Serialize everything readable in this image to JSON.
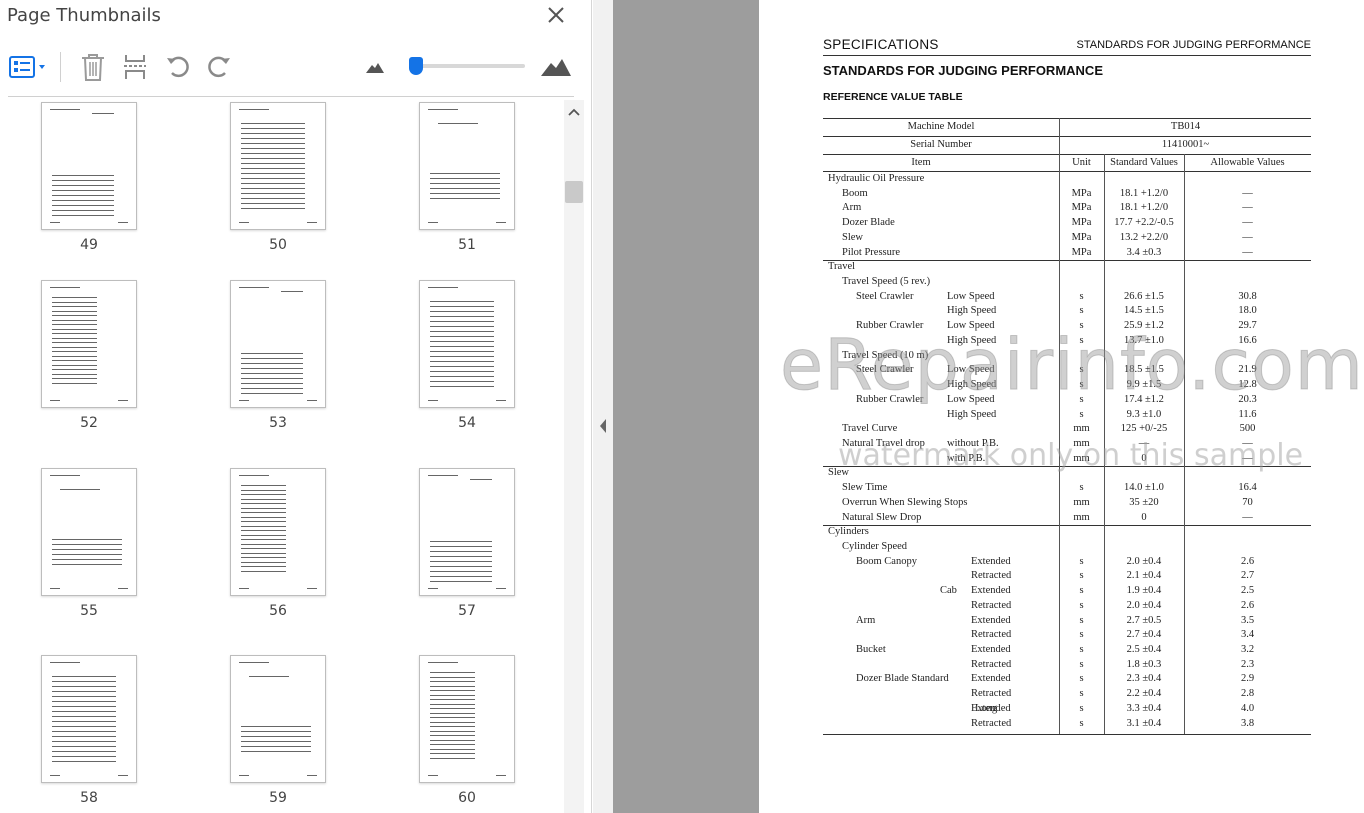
{
  "panel": {
    "title": "Page Thumbnails",
    "close_icon": "close-icon",
    "toolbar": {
      "options_icon": "thumbnail-options-icon",
      "delete_icon": "trash-icon",
      "insert_icon": "insert-pages-icon",
      "undo_icon": "rotate-counterclockwise-icon",
      "redo_icon": "rotate-clockwise-icon",
      "zoom_out_icon": "small-mountain-icon",
      "zoom_in_icon": "large-mountain-icon",
      "zoom_level": 0.05
    },
    "accent_color": "#1473e6",
    "thumbnails": [
      {
        "page": "49"
      },
      {
        "page": "50"
      },
      {
        "page": "51"
      },
      {
        "page": "52"
      },
      {
        "page": "53"
      },
      {
        "page": "54"
      },
      {
        "page": "55"
      },
      {
        "page": "56"
      },
      {
        "page": "57"
      },
      {
        "page": "58"
      },
      {
        "page": "59"
      },
      {
        "page": "60"
      }
    ]
  },
  "document": {
    "header_left": "SPECIFICATIONS",
    "header_right": "STANDARDS FOR JUDGING PERFORMANCE",
    "title": "STANDARDS FOR JUDGING PERFORMANCE",
    "subtitle": "REFERENCE VALUE TABLE",
    "table": {
      "machine_model_label": "Machine Model",
      "machine_model_value": "TB014",
      "serial_label": "Serial Number",
      "serial_value": "11410001~",
      "col_item": "Item",
      "col_unit": "Unit",
      "col_standard": "Standard Values",
      "col_allowable": "Allowable Values",
      "rows": [
        {
          "c1": "Hydraulic Oil Pressure",
          "c2": "",
          "c3": "",
          "unit": "",
          "std": "",
          "allow": ""
        },
        {
          "c1": "",
          "c2": "Boom",
          "c3": "",
          "unit": "MPa",
          "std": "18.1 +1.2/0",
          "allow": "—"
        },
        {
          "c1": "",
          "c2": "Arm",
          "c3": "",
          "unit": "MPa",
          "std": "18.1 +1.2/0",
          "allow": "—"
        },
        {
          "c1": "",
          "c2": "Dozer Blade",
          "c3": "",
          "unit": "MPa",
          "std": "17.7 +2.2/-0.5",
          "allow": "—"
        },
        {
          "c1": "",
          "c2": "Slew",
          "c3": "",
          "unit": "MPa",
          "std": "13.2 +2.2/0",
          "allow": "—"
        },
        {
          "c1": "",
          "c2": "Pilot Pressure",
          "c3": "",
          "unit": "MPa",
          "std": "3.4 ±0.3",
          "allow": "—"
        },
        {
          "c1": "Travel",
          "c2": "",
          "c3": "",
          "unit": "",
          "std": "",
          "allow": ""
        },
        {
          "c1": "",
          "c2": "Travel Speed (5 rev.)",
          "c3": "",
          "unit": "",
          "std": "",
          "allow": ""
        },
        {
          "c1": "",
          "c2": "  Steel Crawler",
          "c3": "Low Speed",
          "unit": "s",
          "std": "26.6 ±1.5",
          "allow": "30.8"
        },
        {
          "c1": "",
          "c2": "",
          "c3": "High Speed",
          "unit": "s",
          "std": "14.5 ±1.5",
          "allow": "18.0"
        },
        {
          "c1": "",
          "c2": "  Rubber Crawler",
          "c3": "Low Speed",
          "unit": "s",
          "std": "25.9 ±1.2",
          "allow": "29.7"
        },
        {
          "c1": "",
          "c2": "",
          "c3": "High Speed",
          "unit": "s",
          "std": "13.7 ±1.0",
          "allow": "16.6"
        },
        {
          "c1": "",
          "c2": "Travel Speed (10 m)",
          "c3": "",
          "unit": "",
          "std": "",
          "allow": ""
        },
        {
          "c1": "",
          "c2": "  Steel Crawler",
          "c3": "Low Speed",
          "unit": "s",
          "std": "18.5 ±1.5",
          "allow": "21.9"
        },
        {
          "c1": "",
          "c2": "",
          "c3": "High Speed",
          "unit": "s",
          "std": "9.9 ±1.5",
          "allow": "12.8"
        },
        {
          "c1": "",
          "c2": "  Rubber Crawler",
          "c3": "Low Speed",
          "unit": "s",
          "std": "17.4 ±1.2",
          "allow": "20.3"
        },
        {
          "c1": "",
          "c2": "",
          "c3": "High Speed",
          "unit": "s",
          "std": "9.3 ±1.0",
          "allow": "11.6"
        },
        {
          "c1": "",
          "c2": "Travel Curve",
          "c3": "",
          "unit": "mm",
          "std": "125 +0/-25",
          "allow": "500"
        },
        {
          "c1": "",
          "c2": "Natural Travel drop",
          "c3": "without P.B.",
          "unit": "mm",
          "std": "—",
          "allow": "—"
        },
        {
          "c1": "",
          "c2": "",
          "c3": "with P.B.",
          "unit": "mm",
          "std": "0",
          "allow": "—"
        },
        {
          "c1": "Slew",
          "c2": "",
          "c3": "",
          "unit": "",
          "std": "",
          "allow": ""
        },
        {
          "c1": "",
          "c2": "Slew Time",
          "c3": "",
          "unit": "s",
          "std": "14.0 ±1.0",
          "allow": "16.4"
        },
        {
          "c1": "",
          "c2": "Overrun When Slewing Stops",
          "c3": "",
          "unit": "mm",
          "std": "35 ±20",
          "allow": "70"
        },
        {
          "c1": "",
          "c2": "Natural Slew Drop",
          "c3": "",
          "unit": "mm",
          "std": "0",
          "allow": "—"
        },
        {
          "c1": "Cylinders",
          "c2": "",
          "c3": "",
          "unit": "",
          "std": "",
          "allow": ""
        },
        {
          "c1": "",
          "c2": "Cylinder Speed",
          "c3": "",
          "unit": "",
          "std": "",
          "allow": ""
        },
        {
          "c1": "",
          "c2": "  Boom    Canopy",
          "c3": "Extended",
          "unit": "s",
          "std": "2.0 ±0.4",
          "allow": "2.6"
        },
        {
          "c1": "",
          "c2": "",
          "c3": "Retracted",
          "unit": "s",
          "std": "2.1 ±0.4",
          "allow": "2.7"
        },
        {
          "c1": "",
          "c2": "              Cab",
          "c3": "Extended",
          "unit": "s",
          "std": "1.9 ±0.4",
          "allow": "2.5"
        },
        {
          "c1": "",
          "c2": "",
          "c3": "Retracted",
          "unit": "s",
          "std": "2.0 ±0.4",
          "allow": "2.6"
        },
        {
          "c1": "",
          "c2": "  Arm",
          "c3": "Extended",
          "unit": "s",
          "std": "2.7 ±0.5",
          "allow": "3.5"
        },
        {
          "c1": "",
          "c2": "",
          "c3": "Retracted",
          "unit": "s",
          "std": "2.7 ±0.4",
          "allow": "3.4"
        },
        {
          "c1": "",
          "c2": "  Bucket",
          "c3": "Extended",
          "unit": "s",
          "std": "2.5 ±0.4",
          "allow": "3.2"
        },
        {
          "c1": "",
          "c2": "",
          "c3": "Retracted",
          "unit": "s",
          "std": "1.8 ±0.3",
          "allow": "2.3"
        },
        {
          "c1": "",
          "c2": "  Dozer Blade  Standard",
          "c3": "Extended",
          "unit": "s",
          "std": "2.3 ±0.4",
          "allow": "2.9"
        },
        {
          "c1": "",
          "c2": "",
          "c3": "Retracted",
          "unit": "s",
          "std": "2.2 ±0.4",
          "allow": "2.8"
        },
        {
          "c1": "",
          "c2": "                   Long",
          "c3": "Extended",
          "unit": "s",
          "std": "3.3 ±0.4",
          "allow": "4.0"
        },
        {
          "c1": "",
          "c2": "",
          "c3": "Retracted",
          "unit": "s",
          "std": "3.1 ±0.4",
          "allow": "3.8"
        }
      ]
    }
  },
  "watermark": {
    "line1": "eRepairinfo.com",
    "line2": "watermark only on this sample"
  }
}
